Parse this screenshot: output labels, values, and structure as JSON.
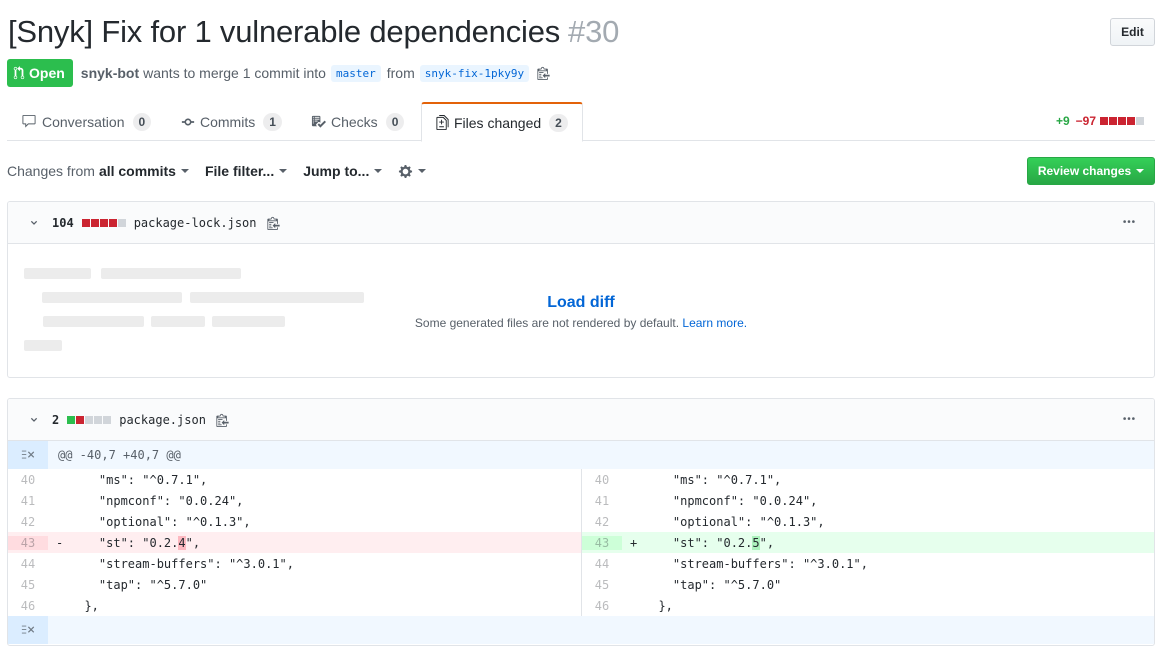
{
  "pr": {
    "title": "[Snyk] Fix for 1 vulnerable dependencies",
    "number": "#30",
    "edit_label": "Edit",
    "state": "Open",
    "author": "snyk-bot",
    "merge_text": "wants to merge 1 commit into",
    "base_branch": "master",
    "from_text": "from",
    "head_branch": "snyk-fix-1pky9y"
  },
  "tabs": [
    {
      "label": "Conversation",
      "count": "0",
      "icon": "comment-icon"
    },
    {
      "label": "Commits",
      "count": "1",
      "icon": "commit-icon"
    },
    {
      "label": "Checks",
      "count": "0",
      "icon": "checklist-icon"
    },
    {
      "label": "Files changed",
      "count": "2",
      "icon": "file-diff-icon",
      "selected": true
    }
  ],
  "diffstat": {
    "additions": "+9",
    "deletions": "−97"
  },
  "toolbar": {
    "changes_from": "Changes from",
    "all_commits": "all commits",
    "file_filter": "File filter...",
    "jump_to": "Jump to...",
    "review_changes": "Review changes"
  },
  "files": [
    {
      "count": "104",
      "name": "package-lock.json",
      "load_diff": "Load diff",
      "note": "Some generated files are not rendered by default.",
      "learn_more": "Learn more."
    },
    {
      "count": "2",
      "name": "package.json",
      "hunk_header": "@@ -40,7 +40,7 @@",
      "left": [
        {
          "ln": "40",
          "sign": "",
          "code": "    \"ms\": \"^0.7.1\","
        },
        {
          "ln": "41",
          "sign": "",
          "code": "    \"npmconf\": \"0.0.24\","
        },
        {
          "ln": "42",
          "sign": "",
          "code": "    \"optional\": \"^0.1.3\","
        },
        {
          "ln": "43",
          "sign": "-",
          "code_pre": "    \"st\": \"0.2.",
          "code_hl": "4",
          "code_post": "\",",
          "type": "del"
        },
        {
          "ln": "44",
          "sign": "",
          "code": "    \"stream-buffers\": \"^3.0.1\","
        },
        {
          "ln": "45",
          "sign": "",
          "code": "    \"tap\": \"^5.7.0\""
        },
        {
          "ln": "46",
          "sign": "",
          "code": "  },"
        }
      ],
      "right": [
        {
          "ln": "40",
          "sign": "",
          "code": "    \"ms\": \"^0.7.1\","
        },
        {
          "ln": "41",
          "sign": "",
          "code": "    \"npmconf\": \"0.0.24\","
        },
        {
          "ln": "42",
          "sign": "",
          "code": "    \"optional\": \"^0.1.3\","
        },
        {
          "ln": "43",
          "sign": "+",
          "code_pre": "    \"st\": \"0.2.",
          "code_hl": "5",
          "code_post": "\",",
          "type": "add"
        },
        {
          "ln": "44",
          "sign": "",
          "code": "    \"stream-buffers\": \"^3.0.1\","
        },
        {
          "ln": "45",
          "sign": "",
          "code": "    \"tap\": \"^5.7.0\""
        },
        {
          "ln": "46",
          "sign": "",
          "code": "  },"
        }
      ]
    }
  ],
  "colors": {
    "accent": "#0366d6",
    "open": "#2cbe4e",
    "tab_border": "#e36209"
  }
}
